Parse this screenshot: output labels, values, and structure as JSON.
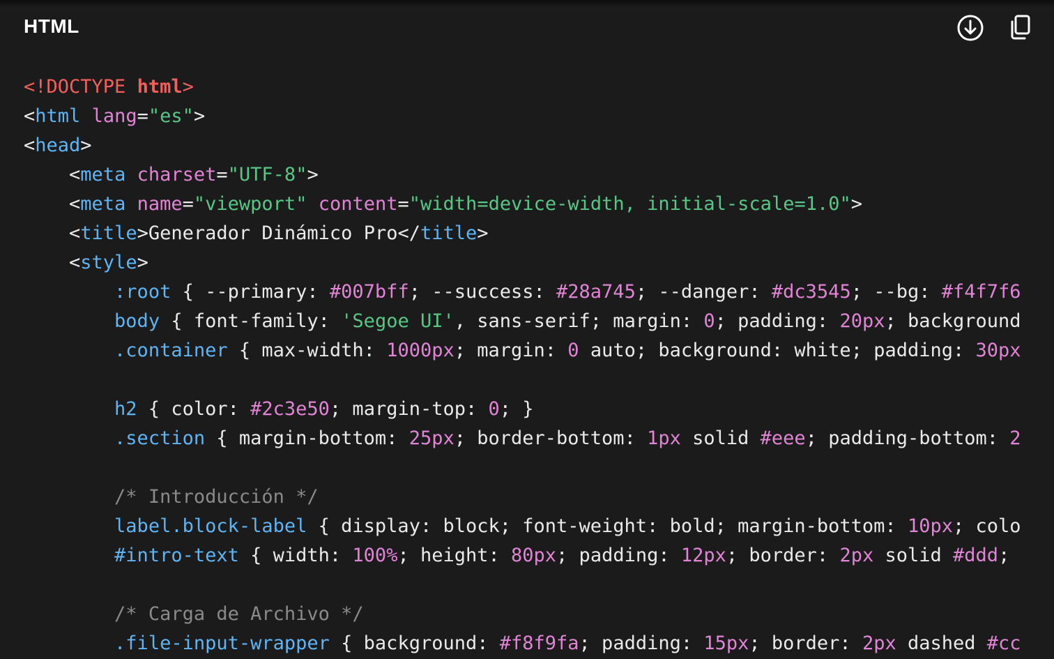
{
  "header": {
    "language": "HTML",
    "download_icon": "download-circle-icon",
    "copy_icon": "copy-icon"
  },
  "colors": {
    "background": "#1b1b1b",
    "tag": "#5fb4f4",
    "attribute": "#e184d6",
    "string": "#57c786",
    "doctype": "#f25f5c",
    "comment": "#8a8a8a",
    "text": "#eaeaea"
  },
  "code_lines": [
    [
      [
        "doctype",
        "<!DOCTYPE "
      ],
      [
        "doctype-kw",
        "html"
      ],
      [
        "doctype",
        ">"
      ]
    ],
    [
      [
        "punct",
        "<"
      ],
      [
        "tag",
        "html"
      ],
      [
        "text",
        " "
      ],
      [
        "attr",
        "lang"
      ],
      [
        "punct",
        "="
      ],
      [
        "string",
        "\"es\""
      ],
      [
        "punct",
        ">"
      ]
    ],
    [
      [
        "punct",
        "<"
      ],
      [
        "tag",
        "head"
      ],
      [
        "punct",
        ">"
      ]
    ],
    [
      [
        "text",
        "    "
      ],
      [
        "punct",
        "<"
      ],
      [
        "tag",
        "meta"
      ],
      [
        "text",
        " "
      ],
      [
        "attr",
        "charset"
      ],
      [
        "punct",
        "="
      ],
      [
        "string",
        "\"UTF-8\""
      ],
      [
        "punct",
        ">"
      ]
    ],
    [
      [
        "text",
        "    "
      ],
      [
        "punct",
        "<"
      ],
      [
        "tag",
        "meta"
      ],
      [
        "text",
        " "
      ],
      [
        "attr",
        "name"
      ],
      [
        "punct",
        "="
      ],
      [
        "string",
        "\"viewport\""
      ],
      [
        "text",
        " "
      ],
      [
        "attr",
        "content"
      ],
      [
        "punct",
        "="
      ],
      [
        "string",
        "\"width=device-width, initial-scale=1.0\""
      ],
      [
        "punct",
        ">"
      ]
    ],
    [
      [
        "text",
        "    "
      ],
      [
        "punct",
        "<"
      ],
      [
        "tag",
        "title"
      ],
      [
        "punct",
        ">"
      ],
      [
        "text",
        "Generador Dinámico Pro"
      ],
      [
        "punct",
        "</"
      ],
      [
        "tag",
        "title"
      ],
      [
        "punct",
        ">"
      ]
    ],
    [
      [
        "text",
        "    "
      ],
      [
        "punct",
        "<"
      ],
      [
        "tag",
        "style"
      ],
      [
        "punct",
        ">"
      ]
    ],
    [
      [
        "text",
        "        "
      ],
      [
        "selector",
        ":root"
      ],
      [
        "text",
        " { --primary: "
      ],
      [
        "number",
        "#007bff"
      ],
      [
        "text",
        "; --success: "
      ],
      [
        "number",
        "#28a745"
      ],
      [
        "text",
        "; --danger: "
      ],
      [
        "number",
        "#dc3545"
      ],
      [
        "text",
        "; --bg: "
      ],
      [
        "number",
        "#f4f7f6"
      ]
    ],
    [
      [
        "text",
        "        "
      ],
      [
        "selector",
        "body"
      ],
      [
        "text",
        " { font-family: "
      ],
      [
        "string",
        "'Segoe UI'"
      ],
      [
        "text",
        ", sans-serif; margin: "
      ],
      [
        "number",
        "0"
      ],
      [
        "text",
        "; padding: "
      ],
      [
        "number",
        "20px"
      ],
      [
        "text",
        "; background"
      ]
    ],
    [
      [
        "text",
        "        "
      ],
      [
        "selector",
        ".container"
      ],
      [
        "text",
        " { max-width: "
      ],
      [
        "number",
        "1000px"
      ],
      [
        "text",
        "; margin: "
      ],
      [
        "number",
        "0"
      ],
      [
        "text",
        " auto; background: white; padding: "
      ],
      [
        "number",
        "30px"
      ]
    ],
    [],
    [
      [
        "text",
        "        "
      ],
      [
        "selector",
        "h2"
      ],
      [
        "text",
        " { color: "
      ],
      [
        "number",
        "#2c3e50"
      ],
      [
        "text",
        "; margin-top: "
      ],
      [
        "number",
        "0"
      ],
      [
        "text",
        "; }"
      ]
    ],
    [
      [
        "text",
        "        "
      ],
      [
        "selector",
        ".section"
      ],
      [
        "text",
        " { margin-bottom: "
      ],
      [
        "number",
        "25px"
      ],
      [
        "text",
        "; border-bottom: "
      ],
      [
        "number",
        "1px"
      ],
      [
        "text",
        " solid "
      ],
      [
        "number",
        "#eee"
      ],
      [
        "text",
        "; padding-bottom: "
      ],
      [
        "number",
        "2"
      ]
    ],
    [],
    [
      [
        "text",
        "        "
      ],
      [
        "comment",
        "/* Introducción */"
      ]
    ],
    [
      [
        "text",
        "        "
      ],
      [
        "selector",
        "label.block-label"
      ],
      [
        "text",
        " { display: block; font-weight: bold; margin-bottom: "
      ],
      [
        "number",
        "10px"
      ],
      [
        "text",
        "; colo"
      ]
    ],
    [
      [
        "text",
        "        "
      ],
      [
        "selector",
        "#intro-text"
      ],
      [
        "text",
        " { width: "
      ],
      [
        "number",
        "100%"
      ],
      [
        "text",
        "; height: "
      ],
      [
        "number",
        "80px"
      ],
      [
        "text",
        "; padding: "
      ],
      [
        "number",
        "12px"
      ],
      [
        "text",
        "; border: "
      ],
      [
        "number",
        "2px"
      ],
      [
        "text",
        " solid "
      ],
      [
        "number",
        "#ddd"
      ],
      [
        "text",
        ";"
      ]
    ],
    [],
    [
      [
        "text",
        "        "
      ],
      [
        "comment",
        "/* Carga de Archivo */"
      ]
    ],
    [
      [
        "text",
        "        "
      ],
      [
        "selector",
        ".file-input-wrapper"
      ],
      [
        "text",
        " { background: "
      ],
      [
        "number",
        "#f8f9fa"
      ],
      [
        "text",
        "; padding: "
      ],
      [
        "number",
        "15px"
      ],
      [
        "text",
        "; border: "
      ],
      [
        "number",
        "2px"
      ],
      [
        "text",
        " dashed "
      ],
      [
        "number",
        "#cc"
      ]
    ]
  ]
}
